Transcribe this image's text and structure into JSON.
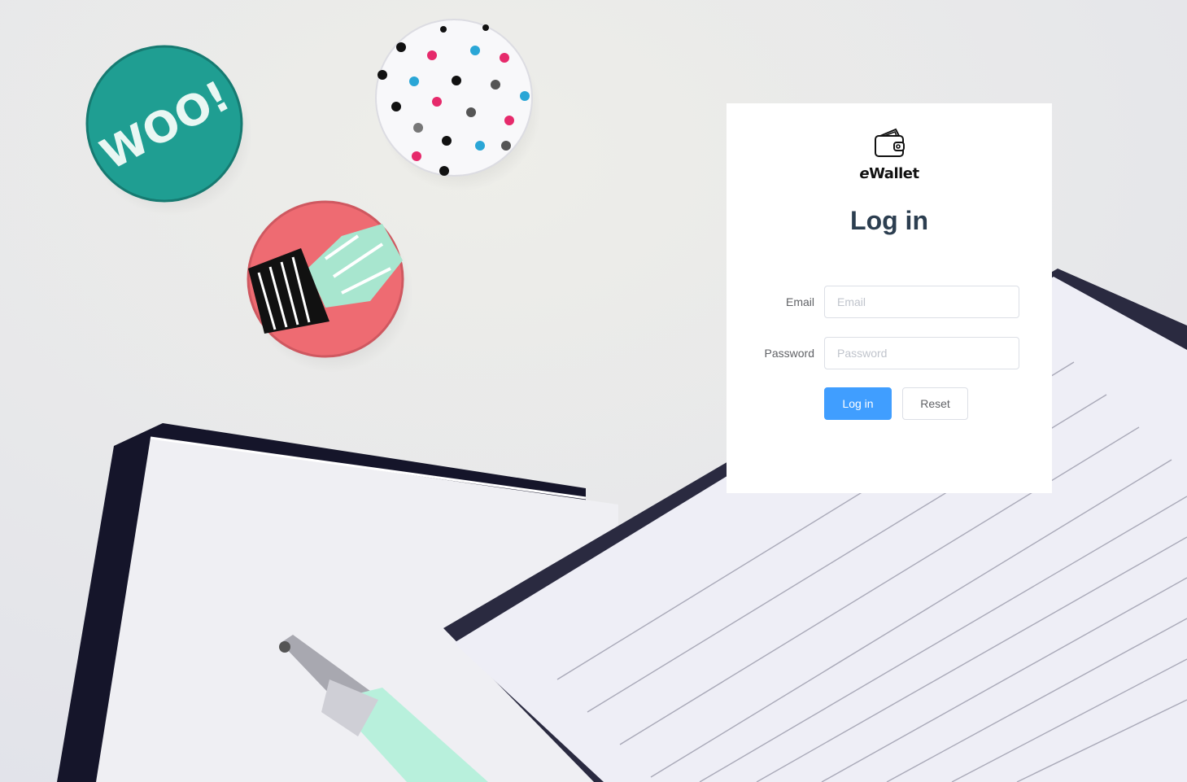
{
  "brand": {
    "name_prefix": "e",
    "name_rest": "Wallet",
    "logo_icon": "wallet-icon"
  },
  "login": {
    "title": "Log in",
    "email_label": "Email",
    "email_placeholder": "Email",
    "email_value": "",
    "password_label": "Password",
    "password_placeholder": "Password",
    "password_value": "",
    "login_button": "Log in",
    "reset_button": "Reset"
  },
  "colors": {
    "primary": "#409eff",
    "title": "#2c3e50",
    "card_background": "#ffffff",
    "woo_badge": "#1f9e92",
    "pink_badge": "#ee6b72",
    "dots_badge": "#f8f8fa",
    "pen_barrel": "#b8f0dc"
  },
  "background": {
    "badges": [
      "woo-badge",
      "polka-dot-badge",
      "cactus-badge"
    ],
    "objects": [
      "notebook",
      "notepad",
      "pen"
    ]
  }
}
